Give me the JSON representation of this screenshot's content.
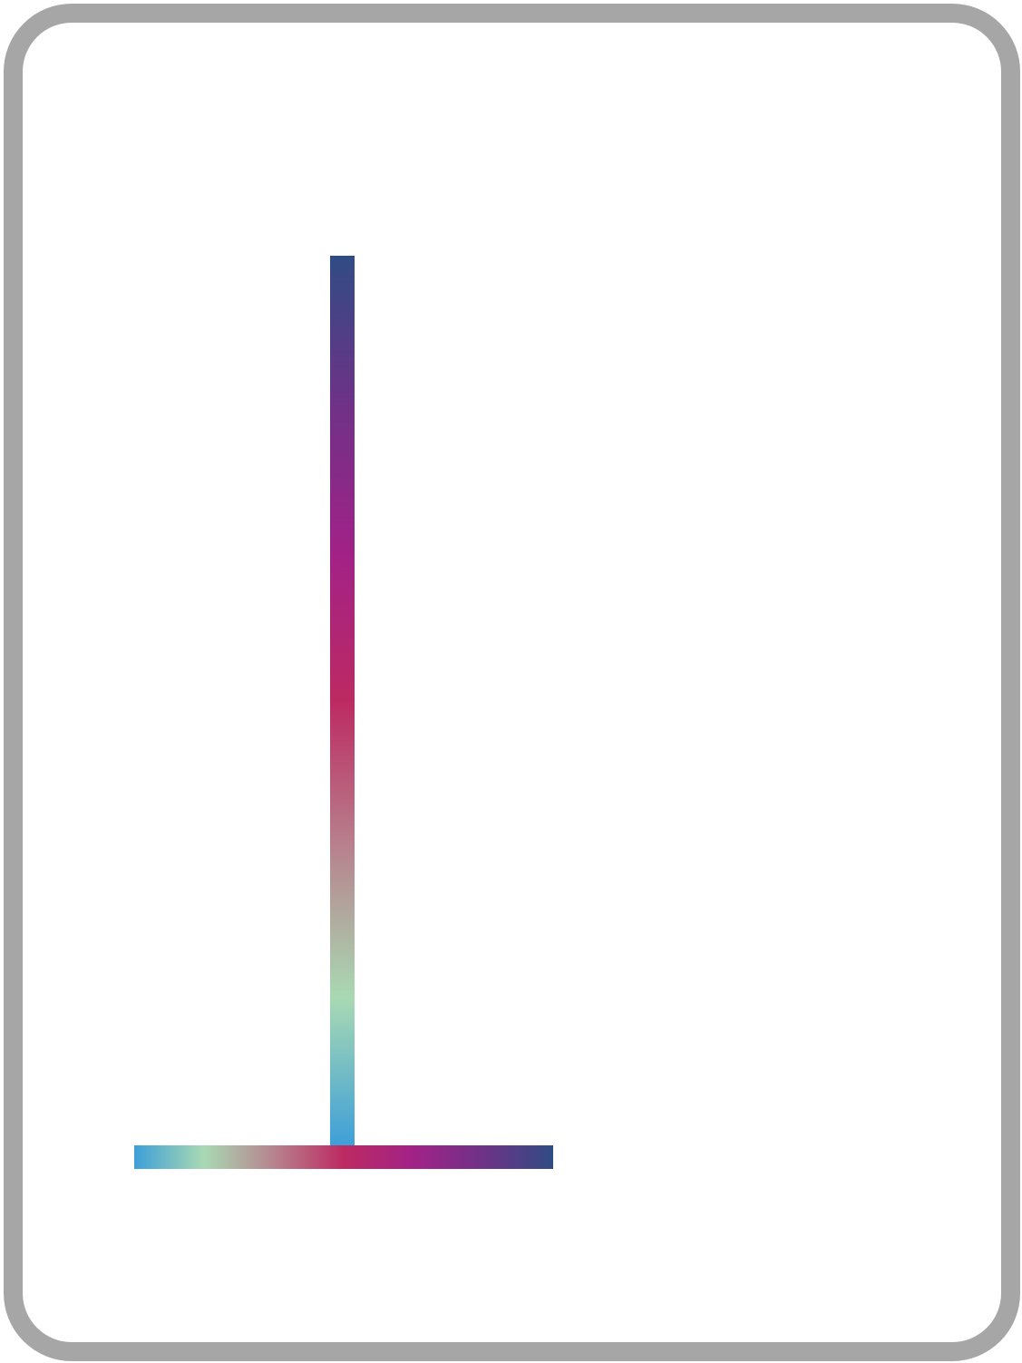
{
  "frame": {
    "border_color": "#a6a6a6",
    "background": "#ffffff"
  },
  "gradient": {
    "stops": [
      "#3d9fd8",
      "#a9d9b3",
      "#b7838e",
      "#bd2a62",
      "#a12287",
      "#6e3287",
      "#304c84"
    ]
  }
}
